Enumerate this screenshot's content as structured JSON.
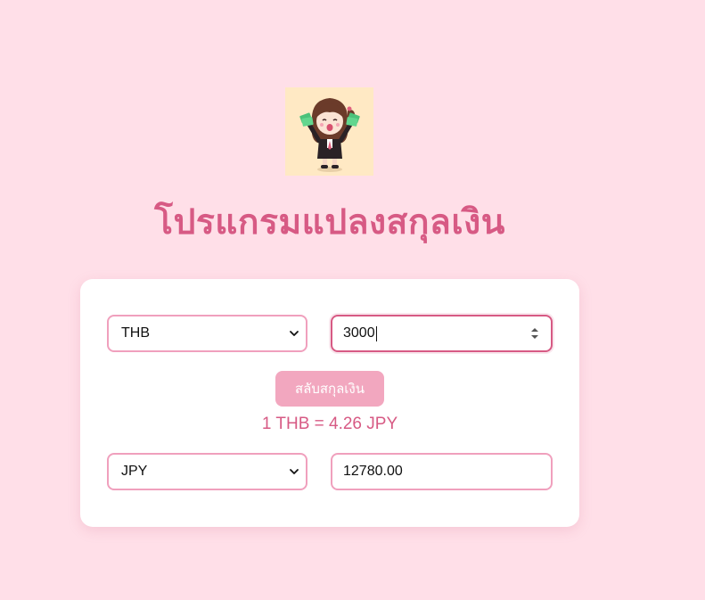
{
  "header": {
    "mascot_icon": "cheerful-girl-holding-money-icon",
    "title": "โปรแกรมแปลงสกุลเงิน"
  },
  "converter": {
    "from_currency": "THB",
    "from_amount": "3000",
    "swap_label": "สลับสกุลเงิน",
    "rate_text": "1 THB = 4.26 JPY",
    "to_currency": "JPY",
    "to_amount": "12780.00"
  },
  "colors": {
    "background": "#ffdfe8",
    "accent": "#d75a84",
    "button": "#f2a7bf",
    "border": "#f0a0bd"
  }
}
